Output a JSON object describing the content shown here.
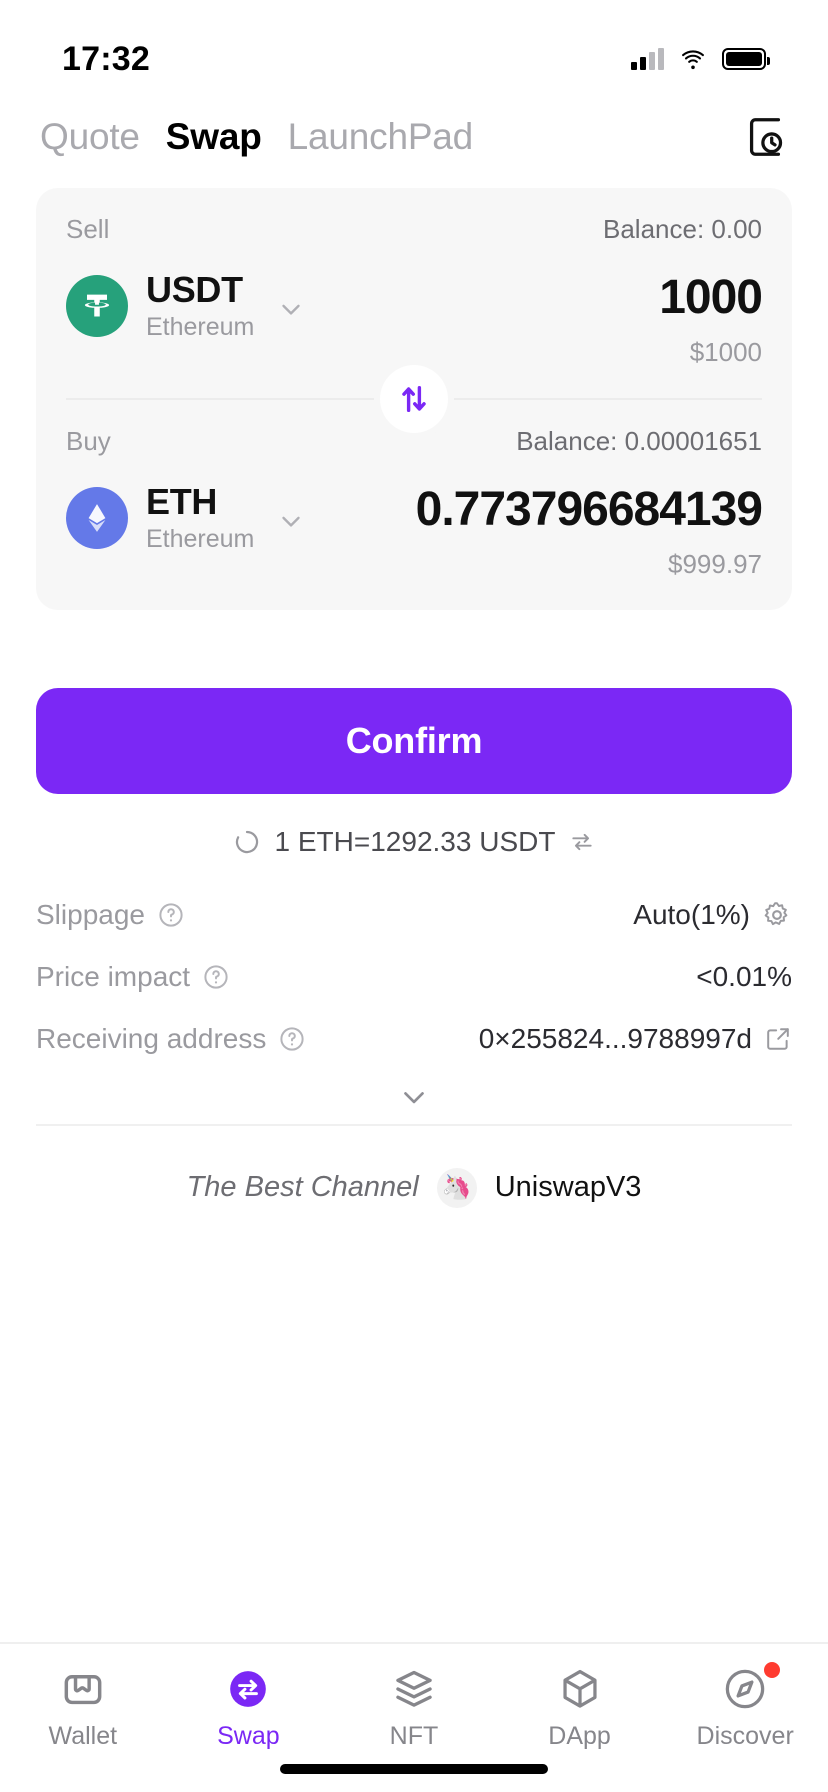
{
  "status_bar": {
    "time": "17:32",
    "cellular_icon": "signal-bars-icon",
    "wifi_icon": "wifi-icon",
    "battery_icon": "battery-icon"
  },
  "header": {
    "tabs": [
      {
        "label": "Quote",
        "active": false
      },
      {
        "label": "Swap",
        "active": true
      },
      {
        "label": "LaunchPad",
        "active": false
      }
    ],
    "history_icon": "history-clock-icon"
  },
  "swap": {
    "sell": {
      "section_label": "Sell",
      "balance_label": "Balance: 0.00",
      "token_symbol": "USDT",
      "token_chain": "Ethereum",
      "token_icon": "tether-icon",
      "token_color": "#26a17b",
      "amount": "1000",
      "fiat": "$1000",
      "chevron_icon": "chevron-down-icon"
    },
    "toggle_icon": "swap-vertical-arrows-icon",
    "toggle_color": "#7b28f5",
    "buy": {
      "section_label": "Buy",
      "balance_label": "Balance: 0.00001651",
      "token_symbol": "ETH",
      "token_chain": "Ethereum",
      "token_icon": "ethereum-icon",
      "token_color": "#6479e8",
      "amount": "0.773796684139",
      "fiat": "$999.97",
      "chevron_icon": "chevron-down-icon"
    }
  },
  "confirm_button": {
    "label": "Confirm",
    "color": "#7b28f5"
  },
  "rate": {
    "refresh_icon": "refresh-spinner-icon",
    "text": "1 ETH=1292.33 USDT",
    "flip_icon": "swap-direction-icon"
  },
  "details": [
    {
      "label": "Slippage",
      "help_icon": "question-mark-icon",
      "value": "Auto(1%)",
      "trailing_icon": "gear-icon"
    },
    {
      "label": "Price impact",
      "help_icon": "question-mark-icon",
      "value": "<0.01%",
      "trailing_icon": ""
    },
    {
      "label": "Receiving address",
      "help_icon": "question-mark-icon",
      "value": "0×255824...9788997d",
      "trailing_icon": "edit-icon"
    }
  ],
  "expand_icon": "chevron-down-icon",
  "channel": {
    "label": "The Best Channel",
    "icon": "unicorn-icon",
    "name": "UniswapV3"
  },
  "bottom_nav": [
    {
      "label": "Wallet",
      "icon": "wallet-icon",
      "active": false,
      "badge": false
    },
    {
      "label": "Swap",
      "icon": "swap-icon",
      "active": true,
      "badge": false
    },
    {
      "label": "NFT",
      "icon": "nft-stack-icon",
      "active": false,
      "badge": false
    },
    {
      "label": "DApp",
      "icon": "dapp-cube-icon",
      "active": false,
      "badge": false
    },
    {
      "label": "Discover",
      "icon": "compass-icon",
      "active": false,
      "badge": true
    }
  ]
}
